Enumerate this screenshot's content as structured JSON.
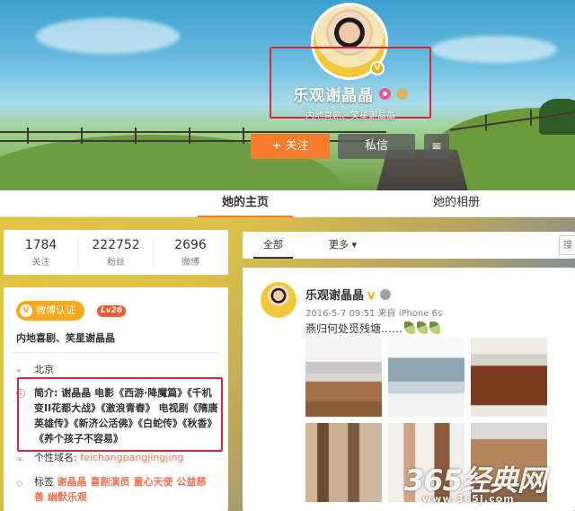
{
  "profile": {
    "name": "乐观谢晶晶",
    "subtitle": "内地喜剧、笑星谢晶晶",
    "verified_mark": "V",
    "vip_mark": "VIP"
  },
  "actions": {
    "follow_label": "+ 关注",
    "message_label": "私信",
    "menu_icon": "≡"
  },
  "tabs": [
    {
      "label": "她的主页"
    },
    {
      "label": "她的相册"
    }
  ],
  "stats": [
    {
      "value": "1784",
      "label": "关注"
    },
    {
      "value": "222752",
      "label": "粉丝"
    },
    {
      "value": "2696",
      "label": "微博"
    }
  ],
  "info": {
    "weibo_cert": "微博认证",
    "cert_mark": "V",
    "level": "Lv26",
    "cert_text": "内地喜剧、笑星谢晶晶",
    "location": "北京",
    "bio_label": "简介:",
    "bio": "谢晶晶 电影《西游·降魔篇》《千机变II花都大战》《激浪青春》 电视剧《隋唐英雄传》《新济公活佛》《白蛇传》《秋香》《养个孩子不容易》",
    "domain_label": "个性域名:",
    "domain": "feichangpangjingjing",
    "tags_label": "标签",
    "tags": [
      "谢晶晶",
      "喜剧演员",
      "童心天使",
      "公益慈善",
      "幽默乐观"
    ]
  },
  "feed": {
    "filter_all": "全部",
    "filter_more": "更多 ▾",
    "search_placeholder": "搜",
    "post": {
      "author": "乐观谢晶晶",
      "verified_mark": "V",
      "meta": "2016-5-7 09:51  来自 iPhone 6s",
      "text": "燕归何处觅残塘……"
    }
  },
  "watermark": {
    "brand": "365经典网",
    "url": "www.365J.com"
  },
  "colors": {
    "accent_orange": "#f77a2a",
    "highlight_red": "#d8263a",
    "cert_gold": "#f7a91b",
    "link_orange": "#eb7350"
  },
  "icons": [
    "location-pin-icon",
    "info-icon",
    "link-icon",
    "tag-icon",
    "hamburger-menu-icon",
    "chevron-down-icon",
    "search-icon"
  ]
}
